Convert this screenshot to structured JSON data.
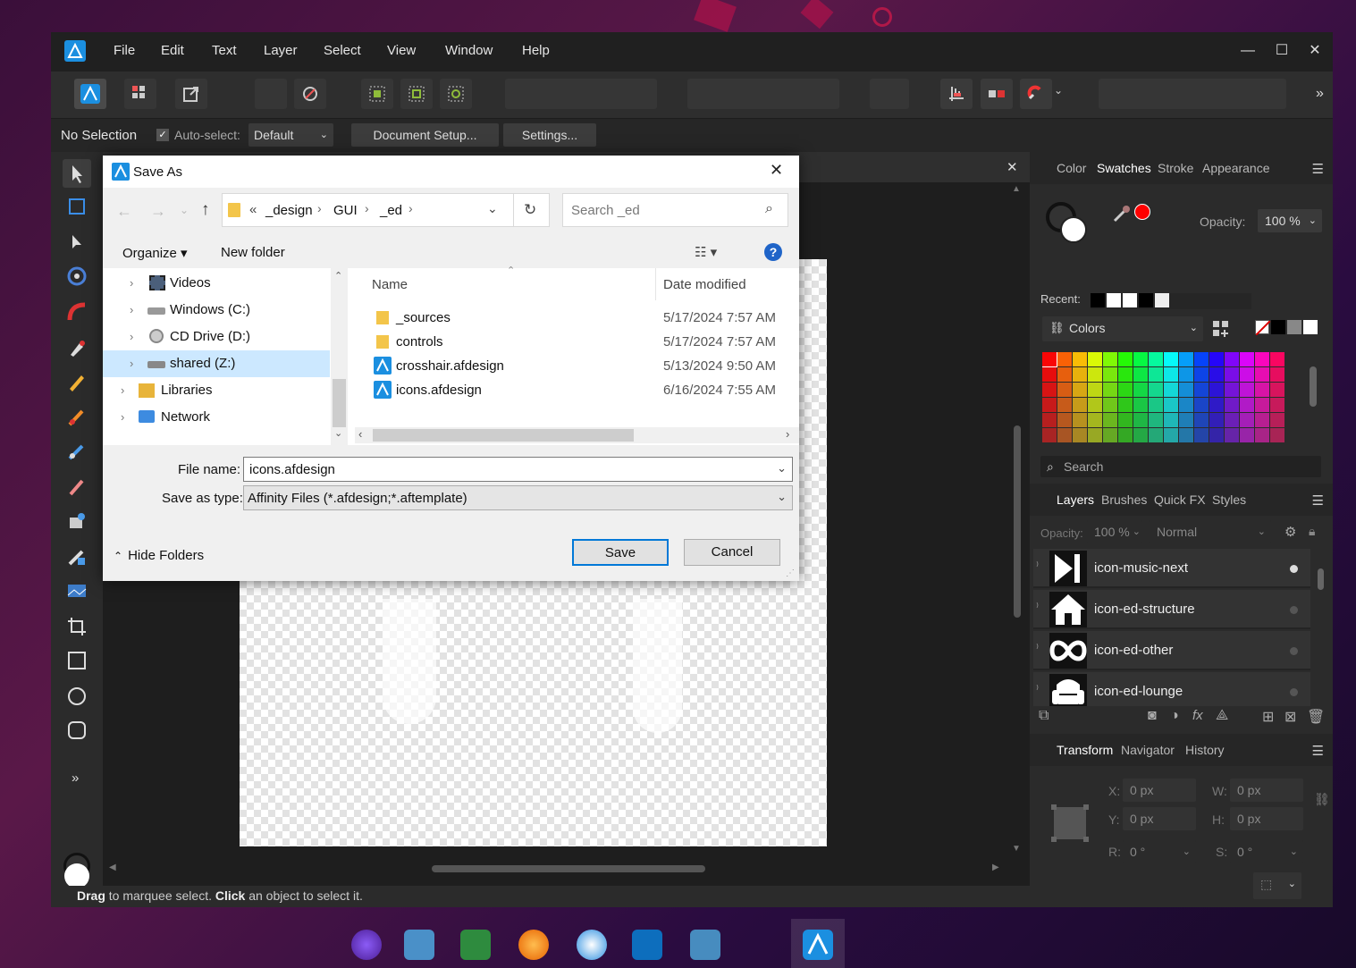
{
  "app": {
    "menu": [
      "File",
      "Edit",
      "Text",
      "Layer",
      "Select",
      "View",
      "Window",
      "Help"
    ],
    "window_controls": {
      "minimize": "—",
      "maximize": "☐",
      "close": "✕"
    },
    "context": {
      "no_selection": "No Selection",
      "auto_select_label": "Auto-select:",
      "auto_select_value": "Default",
      "document_setup": "Document Setup...",
      "settings": "Settings..."
    },
    "status": {
      "bold1": "Drag",
      "text1": " to marquee select. ",
      "bold2": "Click",
      "text2": " an object to select it."
    },
    "more": "»"
  },
  "color_panel": {
    "tabs": [
      "Color",
      "Swatches",
      "Stroke",
      "Appearance"
    ],
    "active_tab": "Swatches",
    "opacity_label": "Opacity:",
    "opacity_value": "100 %",
    "recent_label": "Recent:",
    "palette_name": "Colors",
    "search_placeholder": "Search"
  },
  "layers_panel": {
    "tabs": [
      "Layers",
      "Brushes",
      "Quick FX",
      "Styles"
    ],
    "active_tab": "Layers",
    "opacity_label": "Opacity:",
    "opacity_value": "100 %",
    "blend_mode": "Normal",
    "layers": [
      {
        "name": "icon-music-next",
        "visible": true
      },
      {
        "name": "icon-ed-structure",
        "visible": false
      },
      {
        "name": "icon-ed-other",
        "visible": false
      },
      {
        "name": "icon-ed-lounge",
        "visible": false
      }
    ]
  },
  "transform_panel": {
    "tabs": [
      "Transform",
      "Navigator",
      "History"
    ],
    "active_tab": "Transform",
    "x_label": "X:",
    "x_value": "0 px",
    "y_label": "Y:",
    "y_value": "0 px",
    "w_label": "W:",
    "w_value": "0 px",
    "h_label": "H:",
    "h_value": "0 px",
    "r_label": "R:",
    "r_value": "0 °",
    "s_label": "S:",
    "s_value": "0 °"
  },
  "dialog": {
    "title": "Save As",
    "breadcrumb": [
      "«",
      "_design",
      "GUI",
      "_ed"
    ],
    "search_placeholder": "Search _ed",
    "organize": "Organize ▾",
    "new_folder": "New folder",
    "nav_items": [
      {
        "label": "Videos",
        "icon": "video-folder-icon"
      },
      {
        "label": "Windows (C:)",
        "icon": "drive-icon"
      },
      {
        "label": "CD Drive (D:)",
        "icon": "cd-drive-icon"
      },
      {
        "label": "shared (Z:)",
        "icon": "network-drive-icon"
      },
      {
        "label": "Libraries",
        "icon": "libraries-icon"
      },
      {
        "label": "Network",
        "icon": "network-icon"
      }
    ],
    "columns": {
      "name": "Name",
      "date": "Date modified"
    },
    "files": [
      {
        "name": "_sources",
        "date": "5/17/2024 7:57 AM",
        "type": "folder"
      },
      {
        "name": "controls",
        "date": "5/17/2024 7:57 AM",
        "type": "folder"
      },
      {
        "name": "crosshair.afdesign",
        "date": "5/13/2024 9:50 AM",
        "type": "afdesign"
      },
      {
        "name": "icons.afdesign",
        "date": "6/16/2024 7:55 AM",
        "type": "afdesign"
      }
    ],
    "file_name_label": "File name:",
    "file_name_value": "icons.afdesign",
    "save_type_label": "Save as type:",
    "save_type_value": "Affinity Files (*.afdesign;*.aftemplate)",
    "hide_folders": "Hide Folders",
    "save": "Save",
    "cancel": "Cancel"
  },
  "colors": {
    "app_bg": "#2b2b2b",
    "accent_blue": "#1e88e5",
    "swatch_red": "#ff0000"
  }
}
